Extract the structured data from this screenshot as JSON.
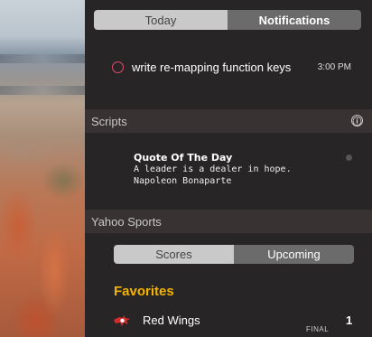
{
  "tabs": {
    "today": "Today",
    "notifications": "Notifications"
  },
  "reminder": {
    "title": "write re-mapping function keys",
    "time": "3:00 PM",
    "accent": "#e04a6a"
  },
  "scripts": {
    "header": "Scripts",
    "info_icon": "ⓘ",
    "quote_title": "Quote Of The Day",
    "quote_text": "A leader is a dealer in hope.",
    "quote_author": "Napoleon Bonaparte"
  },
  "sports": {
    "header": "Yahoo Sports",
    "tabs": {
      "scores": "Scores",
      "upcoming": "Upcoming"
    },
    "favorites_label": "Favorites",
    "favorites_color": "#f5b400",
    "game": {
      "team": "Red Wings",
      "status": "FINAL",
      "score": "1"
    }
  }
}
